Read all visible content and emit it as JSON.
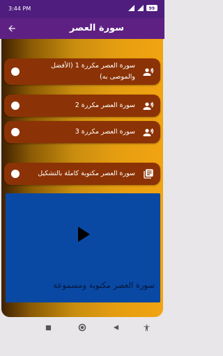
{
  "status_bar": {
    "time": "3:44 PM",
    "battery": "99"
  },
  "app_bar": {
    "title": "سورة العصر",
    "back_icon": "arrow-back-icon",
    "color": "#5e2183"
  },
  "list": {
    "items": [
      {
        "label_line1": "سورة العصر مكررة 1 (الأفضل",
        "label_line2": "والموصى به)",
        "icon": "speaker-voice-icon",
        "selected": false
      },
      {
        "label_line1": "سورة العصر مكررة 2",
        "icon": "speaker-voice-icon",
        "selected": false
      },
      {
        "label_line1": "سورة العصر مكررة 3",
        "icon": "speaker-voice-icon",
        "selected": false
      },
      {
        "label_line1": "سورة العصر مكتوبة كاملة بالتشكيل",
        "icon": "library-books-icon",
        "selected": false
      }
    ],
    "item_color": "#8b3306"
  },
  "video": {
    "caption": "سورة العصر مكتوبة ومسموعة",
    "play_icon": "play-icon",
    "color": "#0a49a3"
  },
  "nav_bar": {
    "buttons": [
      "square-icon",
      "circle-icon",
      "triangle-back-icon",
      "accessibility-icon"
    ]
  }
}
